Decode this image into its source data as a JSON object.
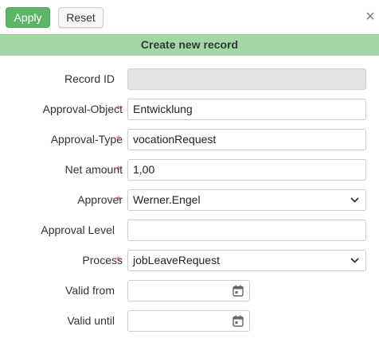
{
  "toolbar": {
    "apply_label": "Apply",
    "reset_label": "Reset",
    "close_glyph": "×"
  },
  "banner": {
    "title": "Create new record"
  },
  "form": {
    "required_marker": "*",
    "fields": [
      {
        "label": "Record ID",
        "value": "",
        "type": "text",
        "disabled": true,
        "required": false
      },
      {
        "label": "Approval-Object",
        "value": "Entwicklung",
        "type": "text",
        "required": true
      },
      {
        "label": "Approval-Type",
        "value": "vocationRequest",
        "type": "text",
        "required": true
      },
      {
        "label": "Net amount",
        "value": "1,00",
        "type": "text",
        "required": true
      },
      {
        "label": "Approver",
        "value": "Werner.Engel",
        "type": "select",
        "required": true
      },
      {
        "label": "Approval Level",
        "value": "",
        "type": "text",
        "required": false
      },
      {
        "label": "Process",
        "value": "jobLeaveRequest",
        "type": "select",
        "required": true
      },
      {
        "label": "Valid from",
        "value": "",
        "type": "date",
        "required": false
      },
      {
        "label": "Valid until",
        "value": "",
        "type": "date",
        "required": false
      }
    ]
  },
  "colors": {
    "apply_green": "#5cb466",
    "banner_green": "#a3d8a5",
    "required_red": "#d9534f"
  }
}
